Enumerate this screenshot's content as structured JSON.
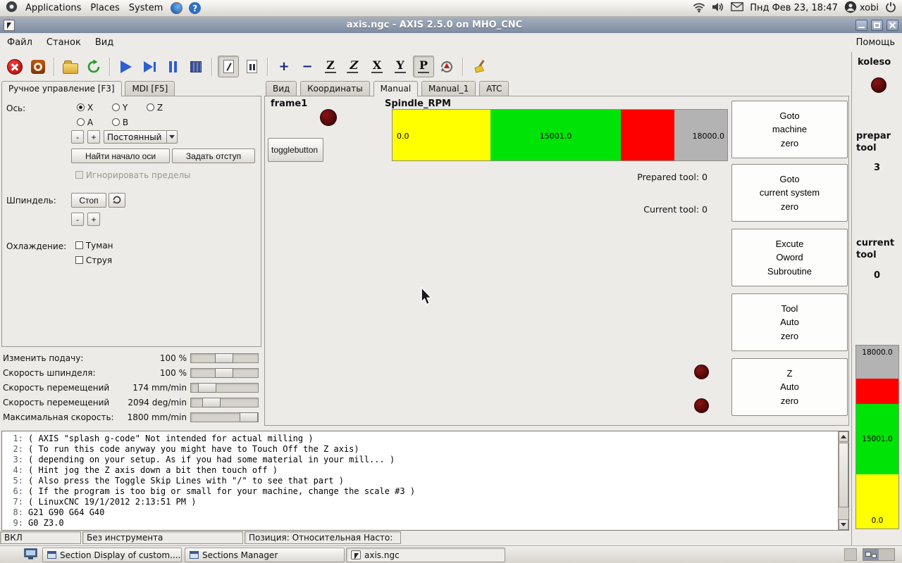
{
  "desktop": {
    "menus": [
      "Applications",
      "Places",
      "System"
    ],
    "help_glyph": "?",
    "clock": "Пнд Фев 23, 18:47",
    "user": "xobi"
  },
  "titlebar": {
    "title": "axis.ngc - AXIS 2.5.0 on MHO_CNC"
  },
  "menubar": {
    "items": [
      "Файл",
      "Станок",
      "Вид"
    ],
    "help": "Помощь"
  },
  "toolbar": {
    "zoom_in": "+",
    "zoom_out": "−",
    "view_z": "Z",
    "view_z2": "Z",
    "view_x": "X",
    "view_y": "Y",
    "view_p": "P"
  },
  "left": {
    "tabs": [
      "Ручное управление [F3]",
      "MDI [F5]"
    ],
    "axis_label": "Ось:",
    "axes": [
      "X",
      "Y",
      "Z",
      "A",
      "B"
    ],
    "jog_minus": "-",
    "jog_plus": "+",
    "jog_mode": "Постоянный",
    "home_axis": "Найти начало оси",
    "set_offset": "Задать отступ",
    "ignore_limits": "Игнорировать пределы",
    "spindle_label": "Шпиндель:",
    "spindle_stop": "Стоп",
    "spindle_minus": "-",
    "spindle_plus": "+",
    "coolant_label": "Охлаждение:",
    "mist": "Туман",
    "flood": "Струя"
  },
  "overrides": {
    "rows": [
      {
        "label": "Изменить подачу:",
        "value": "100 %"
      },
      {
        "label": "Скорость шпинделя:",
        "value": "100 %"
      },
      {
        "label": "Скорость перемещений",
        "value": "174 mm/min"
      },
      {
        "label": "Скорость перемещений",
        "value": "2094 deg/min"
      },
      {
        "label": "Максимальная скорость:",
        "value": "1800 mm/min"
      }
    ]
  },
  "notebook": {
    "tabs": [
      "Вид",
      "Координаты",
      "Manual",
      "Manual_1",
      "ATC"
    ]
  },
  "manual": {
    "frame_label": "frame1",
    "toggle_button": "togglebutton",
    "gauge_title": "Spindle_RPM",
    "gauge_min": "0.0",
    "gauge_mid": "15001.0",
    "gauge_max": "18000.0",
    "prepared_tool": "Prepared tool: 0",
    "current_tool": "Current tool: 0",
    "buttons": [
      "Goto\nmachine\nzero",
      "Goto\ncurrent system\nzero",
      "Excute\nOword\nSubroutine",
      "Tool\nAuto\nzero",
      "Z\nAuto\nzero"
    ]
  },
  "koleso": {
    "title": "koleso",
    "prepar_label": "prepar\ntool",
    "prepar_value": "3",
    "current_label": "current\ntool",
    "current_value": "0",
    "gauge_max": "18000.0",
    "gauge_mid": "15001.0",
    "gauge_min": "0.0"
  },
  "gcode": {
    "lines": [
      {
        "num": "1:",
        "text": "( AXIS \"splash g-code\" Not intended for actual milling )"
      },
      {
        "num": "2:",
        "text": "( To run this code anyway you might have to Touch Off the Z axis)"
      },
      {
        "num": "3:",
        "text": "( depending on your setup. As if you had some material in your mill... )"
      },
      {
        "num": "4:",
        "text": "( Hint jog the Z axis down a bit then touch off )"
      },
      {
        "num": "5:",
        "text": "( Also press the Toggle Skip Lines with \"/\" to see that part )"
      },
      {
        "num": "6:",
        "text": "( If the program is too big or small for your machine, change the scale #3 )"
      },
      {
        "num": "7:",
        "text": "( LinuxCNC 19/1/2012 2:13:51 PM )"
      },
      {
        "num": "8:",
        "text": "G21 G90 G64 G40"
      },
      {
        "num": "9:",
        "text": "G0 Z3.0"
      }
    ]
  },
  "statusbar": {
    "power": "ВКЛ",
    "tool": "Без инструмента",
    "position": "Позиция: Относительная Насто:"
  },
  "taskbar": {
    "items": [
      "Section Display of custom....",
      "Sections Manager",
      "axis.ngc"
    ]
  },
  "colors": {
    "gauge_low": "#ffff00",
    "gauge_mid": "#00e307",
    "gauge_high": "#fe0000",
    "gauge_over": "#b3b3b3",
    "led": "#4a0505"
  }
}
